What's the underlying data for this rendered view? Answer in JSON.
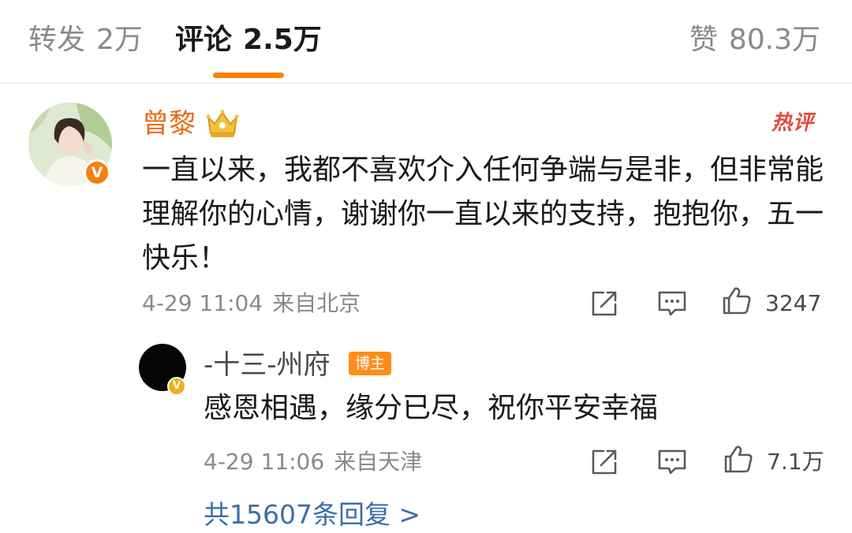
{
  "tabs": {
    "repost_label": "转发",
    "repost_count": "2万",
    "comment_label": "评论",
    "comment_count": "2.5万",
    "like_label": "赞",
    "like_count": "80.3万"
  },
  "main_comment": {
    "username": "曾黎",
    "verified_mark": "V",
    "hot_tag": "热评",
    "text": "一直以来，我都不喜欢介入任何争端与是非，但非常能理解你的心情，谢谢你一直以来的支持，抱抱你，五一快乐！",
    "date": "4-29 11:04",
    "location": "来自北京",
    "likes": "3247"
  },
  "reply": {
    "username": "-十三-州府",
    "verified_mark": "V",
    "owner_tag": "博主",
    "text": "感恩相遇，缘分已尽，祝你平安幸福",
    "date": "4-29 11:06",
    "location": "来自天津",
    "likes": "7.1万"
  },
  "reply_count_link": "共15607条回复 >",
  "icons": [
    "share-icon",
    "comment-icon",
    "like-icon",
    "crown-badge-icon",
    "verified-icon"
  ],
  "colors": {
    "accent": "#ff8200",
    "username": "#e86b14",
    "hot": "#e34a3c",
    "link": "#3d6ea8",
    "muted": "#8a8a8a"
  }
}
